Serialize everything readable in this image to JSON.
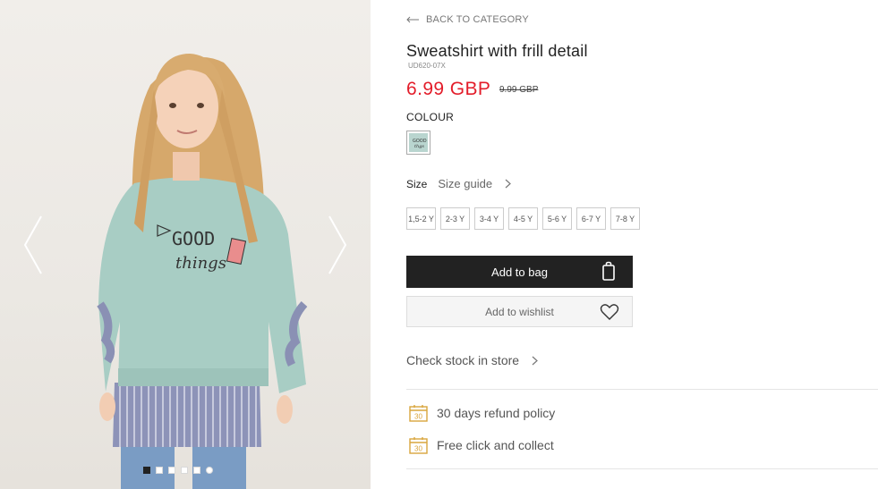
{
  "gallery": {
    "image_alt": "Girl wearing mint sweatshirt with frill detail",
    "print_text": {
      "line1": "GOOD",
      "line2": "things"
    },
    "dots": [
      {
        "active": true
      },
      {
        "active": false
      },
      {
        "active": false
      },
      {
        "active": false
      },
      {
        "active": false
      },
      {
        "active": false,
        "round": true
      }
    ]
  },
  "nav": {
    "back_label": "BACK TO CATEGORY"
  },
  "product": {
    "title": "Sweatshirt with frill detail",
    "sku": "UD620-07X",
    "price": "6.99 GBP",
    "old_price": "9.99 GBP",
    "price_color": "#e31d2a"
  },
  "colour": {
    "label": "COLOUR",
    "swatch_color": "#b9d5cf"
  },
  "size": {
    "label": "Size",
    "guide_label": "Size guide",
    "options": [
      "1,5-2 Y",
      "2-3 Y",
      "3-4 Y",
      "4-5 Y",
      "5-6 Y",
      "6-7 Y",
      "7-8 Y"
    ]
  },
  "actions": {
    "add_to_bag": "Add to bag",
    "add_to_wishlist": "Add to wishlist",
    "check_stock": "Check stock in store"
  },
  "perks": [
    {
      "icon": "calendar-30-icon",
      "icon_text": "30",
      "label": "30 days refund policy"
    },
    {
      "icon": "calendar-30-icon",
      "icon_text": "30",
      "label": "Free click and collect"
    }
  ],
  "colors": {
    "accent": "#e31d2a",
    "button_dark": "#222222",
    "perk_icon": "#d9a53d"
  }
}
